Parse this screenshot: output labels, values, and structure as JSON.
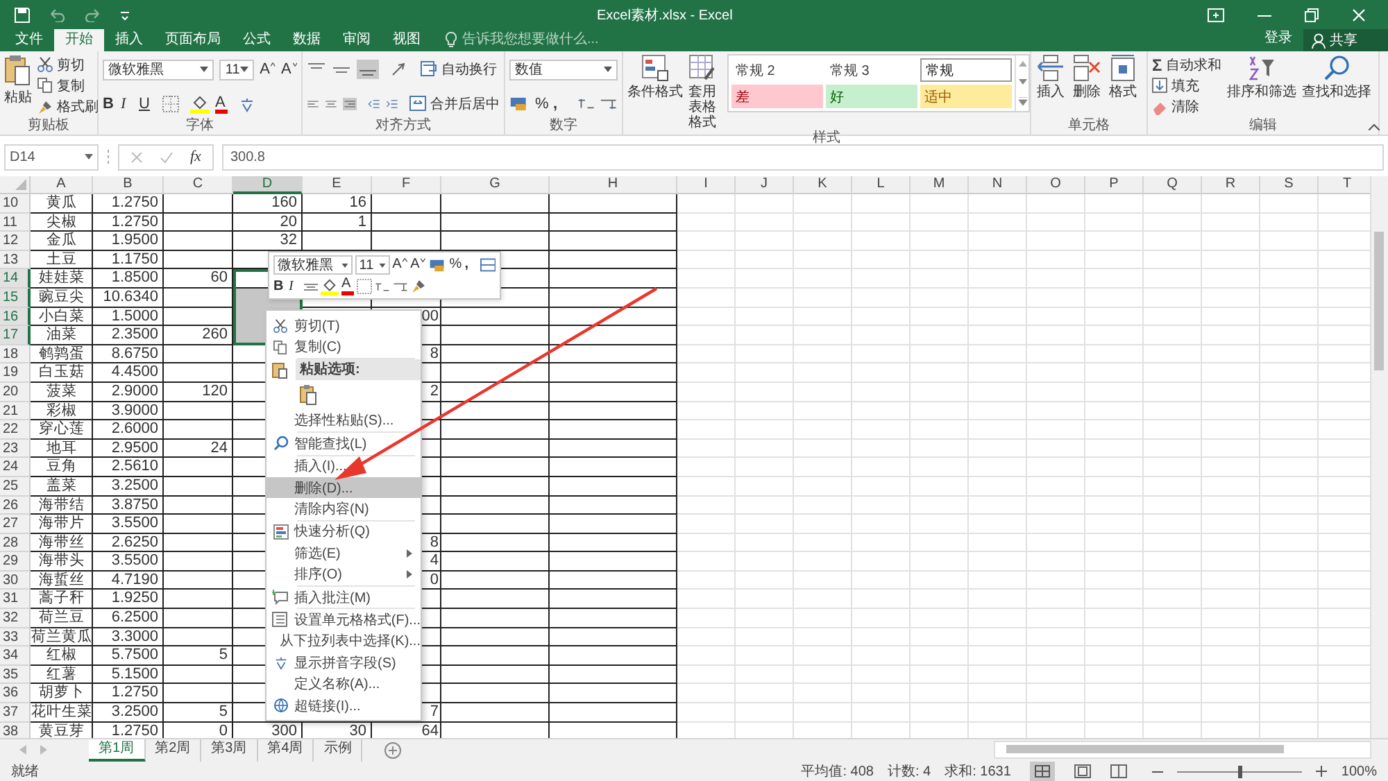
{
  "window": {
    "title": "Excel素材.xlsx - Excel"
  },
  "tabs": [
    {
      "label": "文件",
      "selected": false
    },
    {
      "label": "开始",
      "selected": true
    },
    {
      "label": "插入",
      "selected": false
    },
    {
      "label": "页面布局",
      "selected": false
    },
    {
      "label": "公式",
      "selected": false
    },
    {
      "label": "数据",
      "selected": false
    },
    {
      "label": "审阅",
      "selected": false
    },
    {
      "label": "视图",
      "selected": false
    }
  ],
  "tell_me": {
    "placeholder": "告诉我您想要做什么..."
  },
  "account": {
    "sign_in": "登录",
    "share": "共享"
  },
  "ribbon": {
    "clipboard": {
      "label": "剪贴板",
      "paste": "粘贴",
      "cut": "剪切",
      "copy": "复制",
      "format_painter": "格式刷"
    },
    "font": {
      "label": "字体",
      "font_name": "微软雅黑",
      "font_size": "11",
      "grow": "A",
      "shrink": "A",
      "bold": "B",
      "italic": "I",
      "underline": "U",
      "font_color": "A"
    },
    "alignment": {
      "label": "对齐方式",
      "wrap_text": "自动换行",
      "merge": "合并后居中"
    },
    "number": {
      "label": "数字",
      "format": "数值",
      "percent": "%",
      "comma": ","
    },
    "styles": {
      "label": "样式",
      "conditional": "条件格式",
      "format_table": "套用表格格式",
      "cell_styles": [
        {
          "label": "常规 2",
          "kind": "plain"
        },
        {
          "label": "常规 3",
          "kind": "plain"
        },
        {
          "label": "常规",
          "kind": "normal"
        },
        {
          "label": "差",
          "kind": "bad"
        },
        {
          "label": "好",
          "kind": "good"
        },
        {
          "label": "适中",
          "kind": "neutral"
        }
      ]
    },
    "cells": {
      "label": "单元格",
      "insert": "插入",
      "delete": "删除",
      "format": "格式"
    },
    "editing": {
      "label": "编辑",
      "autosum_sign": "Σ",
      "autosum": "自动求和",
      "fill": "填充",
      "clear": "清除",
      "sort_filter": "排序和筛选",
      "find_select": "查找和选择"
    }
  },
  "formula_bar": {
    "name_box": "D14",
    "function_sign": "fx",
    "formula": "300.8"
  },
  "columns": [
    {
      "label": "A",
      "selected": false
    },
    {
      "label": "B",
      "selected": false
    },
    {
      "label": "C",
      "selected": false
    },
    {
      "label": "D",
      "selected": true
    },
    {
      "label": "E",
      "selected": false
    },
    {
      "label": "F",
      "selected": false
    },
    {
      "label": "G",
      "selected": false
    },
    {
      "label": "H",
      "selected": false
    },
    {
      "label": "I",
      "selected": false
    },
    {
      "label": "J",
      "selected": false
    },
    {
      "label": "K",
      "selected": false
    },
    {
      "label": "L",
      "selected": false
    },
    {
      "label": "M",
      "selected": false
    },
    {
      "label": "N",
      "selected": false
    },
    {
      "label": "O",
      "selected": false
    },
    {
      "label": "P",
      "selected": false
    },
    {
      "label": "Q",
      "selected": false
    },
    {
      "label": "R",
      "selected": false
    },
    {
      "label": "S",
      "selected": false
    },
    {
      "label": "T",
      "selected": false
    }
  ],
  "rows": [
    {
      "n": "10",
      "selected": false,
      "A": "黄瓜",
      "B": "1.2750",
      "D": "160",
      "E": "16"
    },
    {
      "n": "11",
      "selected": false,
      "A": "尖椒",
      "B": "1.2750",
      "D": "20",
      "E": "1"
    },
    {
      "n": "12",
      "selected": false,
      "A": "金瓜",
      "B": "1.9500",
      "D": "32"
    },
    {
      "n": "13",
      "selected": false,
      "A": "土豆",
      "B": "1.1750"
    },
    {
      "n": "14",
      "selected": true,
      "A": "娃娃菜",
      "B": "1.8500",
      "C": "60"
    },
    {
      "n": "15",
      "selected": true,
      "A": "豌豆尖",
      "B": "10.6340"
    },
    {
      "n": "16",
      "selected": true,
      "A": "小白菜",
      "B": "1.5000",
      "F": "00"
    },
    {
      "n": "17",
      "selected": true,
      "A": "油菜",
      "B": "2.3500",
      "C": "260"
    },
    {
      "n": "18",
      "selected": false,
      "A": "鹌鹑蛋",
      "B": "8.6750",
      "F": "8"
    },
    {
      "n": "19",
      "selected": false,
      "A": "白玉菇",
      "B": "4.4500"
    },
    {
      "n": "20",
      "selected": false,
      "A": "菠菜",
      "B": "2.9000",
      "C": "120",
      "F": "2"
    },
    {
      "n": "21",
      "selected": false,
      "A": "彩椒",
      "B": "3.9000"
    },
    {
      "n": "22",
      "selected": false,
      "A": "穿心莲",
      "B": "2.6000"
    },
    {
      "n": "23",
      "selected": false,
      "A": "地耳",
      "B": "2.9500",
      "C": "24"
    },
    {
      "n": "24",
      "selected": false,
      "A": "豆角",
      "B": "2.5610"
    },
    {
      "n": "25",
      "selected": false,
      "A": "盖菜",
      "B": "3.2500"
    },
    {
      "n": "26",
      "selected": false,
      "A": "海带结",
      "B": "3.8750"
    },
    {
      "n": "27",
      "selected": false,
      "A": "海带片",
      "B": "3.5500"
    },
    {
      "n": "28",
      "selected": false,
      "A": "海带丝",
      "B": "2.6250",
      "F": "8"
    },
    {
      "n": "29",
      "selected": false,
      "A": "海带头",
      "B": "3.5500",
      "F": "4"
    },
    {
      "n": "30",
      "selected": false,
      "A": "海蜇丝",
      "B": "4.7190",
      "F": "0"
    },
    {
      "n": "31",
      "selected": false,
      "A": "蒿子秆",
      "B": "1.9250"
    },
    {
      "n": "32",
      "selected": false,
      "A": "荷兰豆",
      "B": "6.2500"
    },
    {
      "n": "33",
      "selected": false,
      "A": "荷兰黄瓜",
      "B": "3.3000"
    },
    {
      "n": "34",
      "selected": false,
      "A": "红椒",
      "B": "5.7500",
      "C": "5"
    },
    {
      "n": "35",
      "selected": false,
      "A": "红薯",
      "B": "5.1500"
    },
    {
      "n": "36",
      "selected": false,
      "A": "胡萝卜",
      "B": "1.2750"
    },
    {
      "n": "37",
      "selected": false,
      "A": "花叶生菜",
      "B": "3.2500",
      "C": "5",
      "F": "7"
    },
    {
      "n": "38",
      "selected": false,
      "A": "黄豆芽",
      "B": "1.2750",
      "C": "0",
      "D": "300",
      "E": "30",
      "F": "64"
    }
  ],
  "mini_toolbar": {
    "font_name": "微软雅黑",
    "font_size": "11",
    "grow": "A",
    "shrink": "A",
    "percent": "%",
    "comma": ",",
    "bold": "B",
    "italic": "I",
    "font_color": "A"
  },
  "context_menu": [
    {
      "label": "剪切(T)",
      "kind": "item",
      "selected": false
    },
    {
      "label": "复制(C)",
      "kind": "item",
      "selected": false
    },
    {
      "label": "粘贴选项:",
      "kind": "header",
      "selected": false
    },
    {
      "kind": "paste",
      "selected": false
    },
    {
      "label": "选择性粘贴(S)...",
      "kind": "item",
      "selected": false
    },
    {
      "label": "智能查找(L)",
      "kind": "item",
      "selected": false
    },
    {
      "label": "插入(I)...",
      "kind": "item",
      "selected": false
    },
    {
      "label": "删除(D)...",
      "kind": "item",
      "selected": true
    },
    {
      "label": "清除内容(N)",
      "kind": "item",
      "selected": false
    },
    {
      "label": "快速分析(Q)",
      "kind": "item",
      "selected": false
    },
    {
      "label": "筛选(E)",
      "kind": "submenu",
      "selected": false
    },
    {
      "label": "排序(O)",
      "kind": "submenu",
      "selected": false
    },
    {
      "label": "插入批注(M)",
      "kind": "item",
      "selected": false
    },
    {
      "label": "设置单元格格式(F)...",
      "kind": "item",
      "selected": false
    },
    {
      "label": "从下拉列表中选择(K)...",
      "kind": "item",
      "selected": false
    },
    {
      "label": "显示拼音字段(S)",
      "kind": "item",
      "selected": false
    },
    {
      "label": "定义名称(A)...",
      "kind": "item",
      "selected": false
    },
    {
      "label": "超链接(I)...",
      "kind": "item",
      "selected": false
    }
  ],
  "sheet_tabs": [
    {
      "label": "第1周",
      "selected": true
    },
    {
      "label": "第2周",
      "selected": false
    },
    {
      "label": "第3周",
      "selected": false
    },
    {
      "label": "第4周",
      "selected": false
    },
    {
      "label": "示例",
      "selected": false
    }
  ],
  "status_bar": {
    "state": "就绪",
    "average": "平均值: 408",
    "count": "计数: 4",
    "sum": "求和: 1631",
    "zoom": "100%",
    "zoom_slider": {
      "level": 0.5
    }
  }
}
